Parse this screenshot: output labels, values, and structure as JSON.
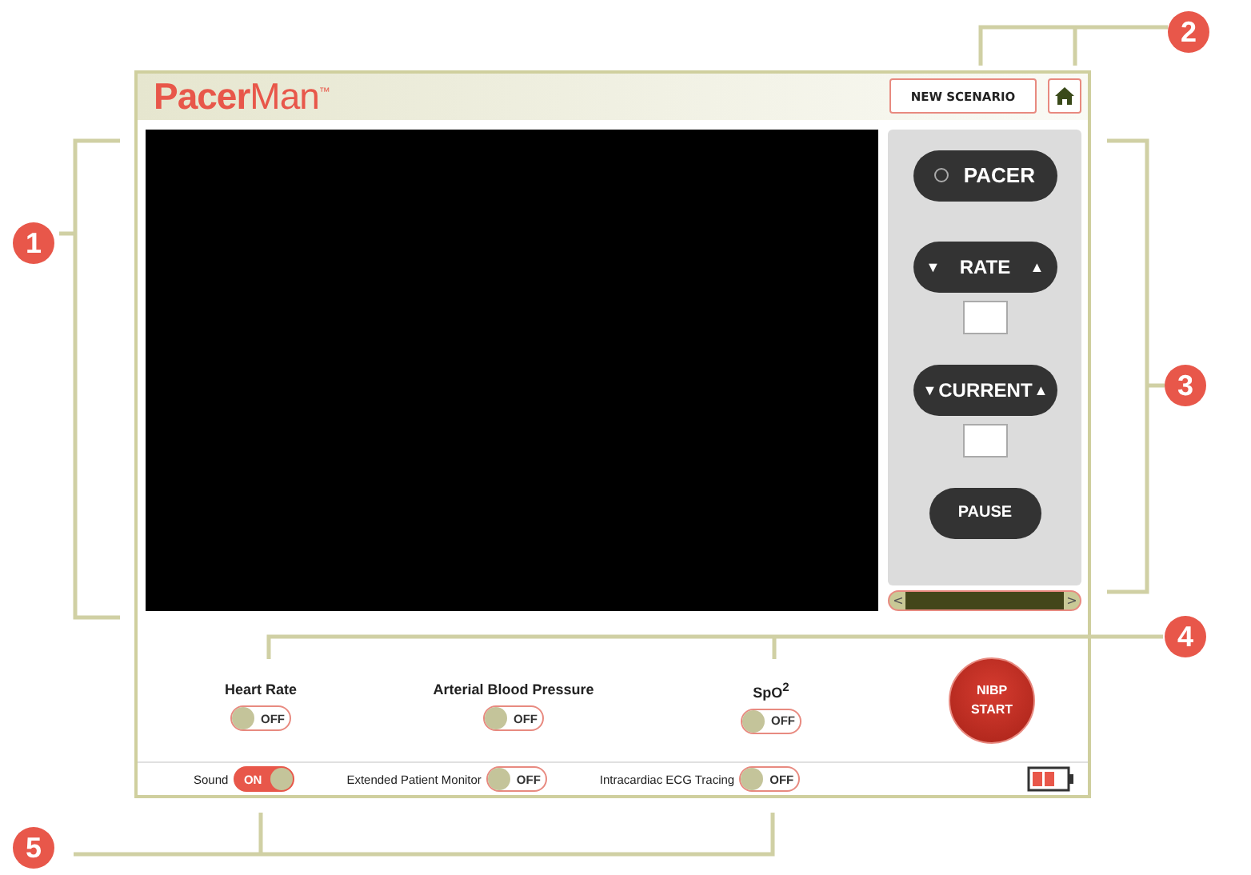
{
  "header": {
    "logo": "**Pacer**Man",
    "logo_mark": "™",
    "new_scenario": "NEW SCENARIO"
  },
  "panel": {
    "pacer": {
      "label": "PACER",
      "on": false
    },
    "rate": {
      "label": "RATE",
      "down": "▼",
      "up": "▲"
    },
    "current": {
      "label": "CURRENT",
      "down": "▼",
      "up": "▲"
    },
    "pause": "PAUSE",
    "scroll_left": "<",
    "scroll_right": ">"
  },
  "monitors": [
    {
      "label": "Heart Rate",
      "on": false,
      "state_text": "OFF"
    },
    {
      "label": "Arterial Blood Pressure",
      "on": false,
      "state_text": "OFF"
    },
    {
      "label": "SpO$^{2}$",
      "on": false,
      "state_text": "OFF"
    }
  ],
  "nibp": [
    "NIBP",
    "START"
  ],
  "options": [
    {
      "label": "Sound",
      "on": true,
      "state_text": "ON"
    },
    {
      "label": "Extended Patient Monitor",
      "on": false,
      "state_text": "OFF"
    },
    {
      "label": "Intracardiac ECG Tracing",
      "on": false,
      "state_text": "OFF"
    }
  ],
  "callouts": [
    "1",
    "2",
    "3",
    "4",
    "5"
  ]
}
